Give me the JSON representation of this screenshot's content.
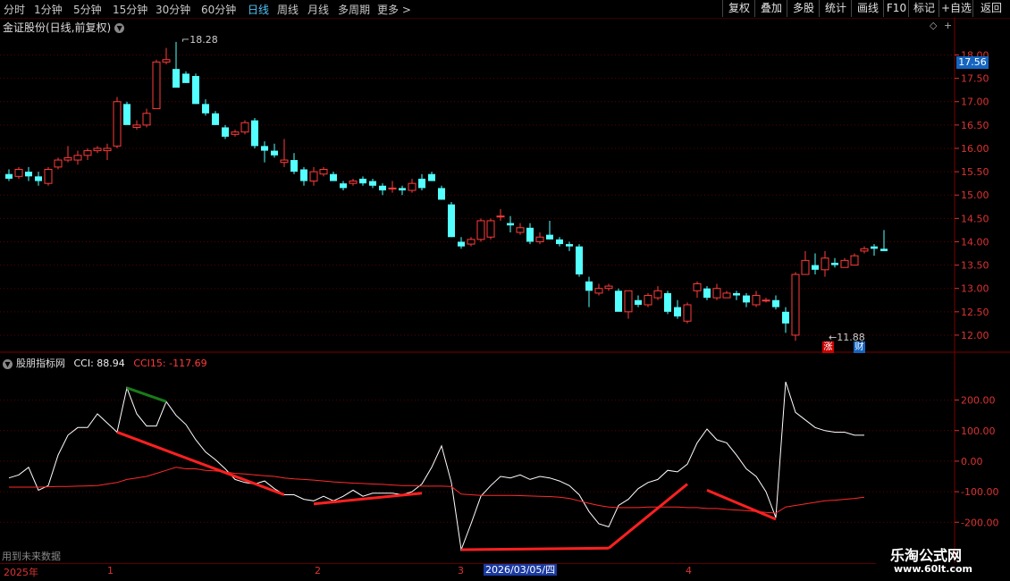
{
  "toolbar": {
    "periods": [
      {
        "label": "分时",
        "active": false
      },
      {
        "label": "1分钟",
        "active": false
      },
      {
        "label": "5分钟",
        "active": false
      },
      {
        "label": "15分钟",
        "active": false
      },
      {
        "label": "30分钟",
        "active": false
      },
      {
        "label": "60分钟",
        "active": false
      },
      {
        "label": "日线",
        "active": true
      },
      {
        "label": "周线",
        "active": false
      },
      {
        "label": "月线",
        "active": false
      },
      {
        "label": "多周期",
        "active": false
      },
      {
        "label": "更多 >",
        "active": false
      }
    ],
    "buttons": [
      "复权",
      "叠加",
      "多股",
      "统计",
      "画线",
      "F10",
      "标记",
      "+自选",
      "返回"
    ]
  },
  "main": {
    "title": "金证股份(日线,前复权)",
    "current_price": "17.56",
    "high_label": "18.28",
    "low_label": "11.88",
    "badge_zhang": "涨",
    "badge_cai": "财"
  },
  "indicator": {
    "name": "股朋指标网",
    "cci_label": "CCI: 88.94",
    "cci15_label": "CCI15: -117.69"
  },
  "footer": {
    "future_data_label": "用到未来数据",
    "year_label": "2025年",
    "selected_date": "2026/03/05/四",
    "month_marks": [
      "1",
      "2",
      "3",
      "4"
    ]
  },
  "watermark": {
    "line1": "乐淘公式网",
    "line2": "www.60lt.com"
  },
  "chart_data": [
    {
      "type": "candlestick",
      "title": "金证股份(日线,前复权)",
      "yticks": [
        12.0,
        12.5,
        13.0,
        13.5,
        14.0,
        14.5,
        15.0,
        15.5,
        16.0,
        16.5,
        17.0,
        17.5,
        18.0
      ],
      "ylim": [
        11.75,
        18.45
      ],
      "colors": {
        "up": "#ff3b3b",
        "down": "#54ffff",
        "grid": "#5a0000"
      },
      "ohlc": [
        [
          15.45,
          15.55,
          15.3,
          15.35
        ],
        [
          15.4,
          15.6,
          15.35,
          15.55
        ],
        [
          15.5,
          15.6,
          15.3,
          15.4
        ],
        [
          15.4,
          15.5,
          15.2,
          15.3
        ],
        [
          15.25,
          15.6,
          15.2,
          15.55
        ],
        [
          15.6,
          15.8,
          15.55,
          15.75
        ],
        [
          15.75,
          16.05,
          15.7,
          15.8
        ],
        [
          15.75,
          15.95,
          15.65,
          15.85
        ],
        [
          15.85,
          16.0,
          15.75,
          15.95
        ],
        [
          15.95,
          16.05,
          15.9,
          16.0
        ],
        [
          15.95,
          16.1,
          15.75,
          16.0
        ],
        [
          16.05,
          17.1,
          16.0,
          17.0
        ],
        [
          16.95,
          17.0,
          16.6,
          16.5
        ],
        [
          16.45,
          16.6,
          16.4,
          16.5
        ],
        [
          16.5,
          16.85,
          16.45,
          16.75
        ],
        [
          16.85,
          17.9,
          16.85,
          17.85
        ],
        [
          17.85,
          18.15,
          17.8,
          17.9
        ],
        [
          17.7,
          18.28,
          17.55,
          17.3
        ],
        [
          17.6,
          17.65,
          17.4,
          17.4
        ],
        [
          17.55,
          17.6,
          16.95,
          16.95
        ],
        [
          16.95,
          17.05,
          16.7,
          16.75
        ],
        [
          16.75,
          16.8,
          16.5,
          16.5
        ],
        [
          16.45,
          16.5,
          16.2,
          16.25
        ],
        [
          16.3,
          16.4,
          16.25,
          16.35
        ],
        [
          16.35,
          16.6,
          16.3,
          16.55
        ],
        [
          16.6,
          16.65,
          16.0,
          16.05
        ],
        [
          16.05,
          16.15,
          15.7,
          15.95
        ],
        [
          15.95,
          16.1,
          15.8,
          15.85
        ],
        [
          15.7,
          16.2,
          15.6,
          15.75
        ],
        [
          15.75,
          15.9,
          15.45,
          15.5
        ],
        [
          15.55,
          15.6,
          15.2,
          15.3
        ],
        [
          15.3,
          15.6,
          15.2,
          15.5
        ],
        [
          15.45,
          15.6,
          15.4,
          15.55
        ],
        [
          15.45,
          15.5,
          15.3,
          15.3
        ],
        [
          15.25,
          15.3,
          15.1,
          15.15
        ],
        [
          15.25,
          15.35,
          15.2,
          15.3
        ],
        [
          15.35,
          15.4,
          15.2,
          15.25
        ],
        [
          15.3,
          15.35,
          15.15,
          15.2
        ],
        [
          15.2,
          15.25,
          15.0,
          15.1
        ],
        [
          15.15,
          15.3,
          15.05,
          15.15
        ],
        [
          15.15,
          15.2,
          15.0,
          15.1
        ],
        [
          15.1,
          15.35,
          15.05,
          15.25
        ],
        [
          15.35,
          15.45,
          15.1,
          15.15
        ],
        [
          15.45,
          15.5,
          15.35,
          15.3
        ],
        [
          15.15,
          15.2,
          14.9,
          14.9
        ],
        [
          14.8,
          14.85,
          14.1,
          14.1
        ],
        [
          14.0,
          14.1,
          13.85,
          13.9
        ],
        [
          13.95,
          14.1,
          13.9,
          14.05
        ],
        [
          14.05,
          14.5,
          14.0,
          14.45
        ],
        [
          14.1,
          14.5,
          14.05,
          14.45
        ],
        [
          14.55,
          14.7,
          14.45,
          14.55
        ],
        [
          14.4,
          14.55,
          14.2,
          14.35
        ],
        [
          14.2,
          14.4,
          14.15,
          14.3
        ],
        [
          14.3,
          14.4,
          13.95,
          14.0
        ],
        [
          14.0,
          14.2,
          13.95,
          14.1
        ],
        [
          14.15,
          14.45,
          14.05,
          14.05
        ],
        [
          14.05,
          14.1,
          13.9,
          13.95
        ],
        [
          13.95,
          14.0,
          13.8,
          13.9
        ],
        [
          13.9,
          13.95,
          13.25,
          13.3
        ],
        [
          13.15,
          13.25,
          12.6,
          12.95
        ],
        [
          12.9,
          13.1,
          12.85,
          13.0
        ],
        [
          13.0,
          13.1,
          12.95,
          13.05
        ],
        [
          12.95,
          13.0,
          12.7,
          12.5
        ],
        [
          12.5,
          12.95,
          12.35,
          12.95
        ],
        [
          12.75,
          12.85,
          12.6,
          12.65
        ],
        [
          12.65,
          12.9,
          12.6,
          12.85
        ],
        [
          12.8,
          13.05,
          12.75,
          12.95
        ],
        [
          12.9,
          12.95,
          12.45,
          12.5
        ],
        [
          12.6,
          12.75,
          12.35,
          12.4
        ],
        [
          12.3,
          12.7,
          12.25,
          12.65
        ],
        [
          12.95,
          13.15,
          12.8,
          13.1
        ],
        [
          13.0,
          13.05,
          12.75,
          12.8
        ],
        [
          12.8,
          13.1,
          12.75,
          13.0
        ],
        [
          12.8,
          12.95,
          12.8,
          12.9
        ],
        [
          12.9,
          12.95,
          12.75,
          12.85
        ],
        [
          12.85,
          12.9,
          12.6,
          12.7
        ],
        [
          12.65,
          12.95,
          12.6,
          12.85
        ],
        [
          12.75,
          12.8,
          12.7,
          12.75
        ],
        [
          12.75,
          12.85,
          12.55,
          12.6
        ],
        [
          12.5,
          12.6,
          12.05,
          12.25
        ],
        [
          12.0,
          13.35,
          11.88,
          13.3
        ],
        [
          13.3,
          13.8,
          13.3,
          13.6
        ],
        [
          13.5,
          13.75,
          13.3,
          13.4
        ],
        [
          13.4,
          13.8,
          13.25,
          13.65
        ],
        [
          13.55,
          13.65,
          13.45,
          13.5
        ],
        [
          13.45,
          13.65,
          13.45,
          13.6
        ],
        [
          13.5,
          13.75,
          13.5,
          13.7
        ],
        [
          13.8,
          13.9,
          13.75,
          13.85
        ],
        [
          13.9,
          13.95,
          13.7,
          13.85
        ],
        [
          13.85,
          14.25,
          13.8,
          13.8
        ]
      ]
    },
    {
      "type": "line",
      "title": "股朋指标网",
      "yticks": [
        -200,
        -100,
        0,
        100,
        200
      ],
      "ylim": [
        -290,
        310
      ],
      "series": [
        {
          "name": "CCI",
          "color": "#ffffff",
          "values": [
            -55,
            -45,
            -20,
            -95,
            -80,
            20,
            85,
            110,
            110,
            155,
            125,
            95,
            240,
            155,
            115,
            115,
            195,
            150,
            120,
            70,
            30,
            5,
            -25,
            -60,
            -70,
            -75,
            -65,
            -90,
            -110,
            -110,
            -125,
            -130,
            -115,
            -130,
            -115,
            -95,
            -115,
            -105,
            -105,
            -105,
            -110,
            -100,
            -75,
            -20,
            50,
            -70,
            -290,
            -205,
            -115,
            -80,
            -50,
            -55,
            -45,
            -60,
            -50,
            -55,
            -65,
            -80,
            -110,
            -165,
            -205,
            -215,
            -145,
            -125,
            -90,
            -70,
            -60,
            -30,
            -35,
            -10,
            60,
            105,
            70,
            60,
            20,
            -25,
            -50,
            -100,
            -185,
            260,
            160,
            135,
            110,
            100,
            95,
            95,
            85,
            85
          ]
        },
        {
          "name": "CCI15",
          "color": "#ff2a2a",
          "values": [
            -85,
            -85,
            -85,
            -85,
            -84,
            -83,
            -83,
            -82,
            -81,
            -80,
            -75,
            -70,
            -60,
            -55,
            -50,
            -40,
            -30,
            -20,
            -25,
            -25,
            -30,
            -32,
            -35,
            -40,
            -42,
            -45,
            -48,
            -50,
            -55,
            -58,
            -60,
            -62,
            -65,
            -68,
            -70,
            -72,
            -73,
            -75,
            -76,
            -78,
            -80,
            -80,
            -82,
            -82,
            -82,
            -83,
            -108,
            -110,
            -112,
            -112,
            -112,
            -112,
            -113,
            -114,
            -115,
            -116,
            -118,
            -122,
            -130,
            -138,
            -145,
            -150,
            -152,
            -152,
            -152,
            -150,
            -150,
            -150,
            -150,
            -152,
            -152,
            -155,
            -155,
            -158,
            -160,
            -162,
            -165,
            -168,
            -170,
            -150,
            -145,
            -140,
            -135,
            -130,
            -128,
            -125,
            -122,
            -118
          ]
        }
      ],
      "divergence_lines": [
        {
          "color": "#ff2020",
          "from": [
            11,
            95
          ],
          "to": [
            28,
            -110
          ]
        },
        {
          "color": "#ff2020",
          "from": [
            31,
            -140
          ],
          "to": [
            42,
            -105
          ]
        },
        {
          "color": "#ff2020",
          "from": [
            46,
            -290
          ],
          "to": [
            61,
            -285
          ]
        },
        {
          "color": "#ff2020",
          "from": [
            61,
            -285
          ],
          "to": [
            69,
            -75
          ]
        },
        {
          "color": "#ff2020",
          "from": [
            71,
            -95
          ],
          "to": [
            78,
            -190
          ]
        },
        {
          "color": "#1a7a1a",
          "from": [
            12,
            240
          ],
          "to": [
            16,
            195
          ]
        }
      ]
    }
  ]
}
